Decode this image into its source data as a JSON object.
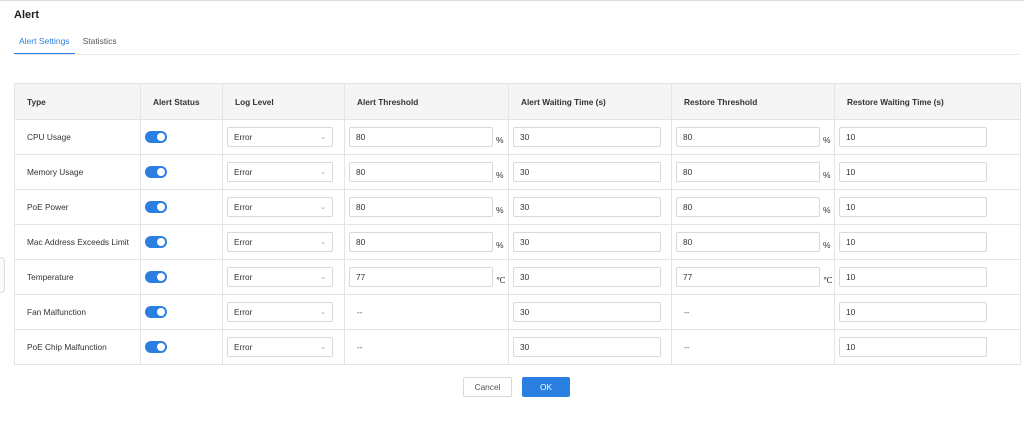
{
  "page": {
    "title": "Alert"
  },
  "tabs": [
    {
      "label": "Alert Settings",
      "active": true
    },
    {
      "label": "Statistics",
      "active": false
    }
  ],
  "table": {
    "headers": [
      "Type",
      "Alert Status",
      "Log Level",
      "Alert Threshold",
      "Alert Waiting Time (s)",
      "Restore Threshold",
      "Restore Waiting Time (s)"
    ],
    "rows": [
      {
        "type": "CPU Usage",
        "alert_status": true,
        "log_level": "Error",
        "alert_threshold": "80",
        "alert_unit": "%",
        "alert_wait": "30",
        "restore_threshold": "80",
        "restore_unit": "%",
        "restore_wait": "10"
      },
      {
        "type": "Memory Usage",
        "alert_status": true,
        "log_level": "Error",
        "alert_threshold": "80",
        "alert_unit": "%",
        "alert_wait": "30",
        "restore_threshold": "80",
        "restore_unit": "%",
        "restore_wait": "10"
      },
      {
        "type": "PoE Power",
        "alert_status": true,
        "log_level": "Error",
        "alert_threshold": "80",
        "alert_unit": "%",
        "alert_wait": "30",
        "restore_threshold": "80",
        "restore_unit": "%",
        "restore_wait": "10"
      },
      {
        "type": "Mac Address Exceeds Limit",
        "alert_status": true,
        "log_level": "Error",
        "alert_threshold": "80",
        "alert_unit": "%",
        "alert_wait": "30",
        "restore_threshold": "80",
        "restore_unit": "%",
        "restore_wait": "10"
      },
      {
        "type": "Temperature",
        "alert_status": true,
        "log_level": "Error",
        "alert_threshold": "77",
        "alert_unit": "℃",
        "alert_wait": "30",
        "restore_threshold": "77",
        "restore_unit": "℃",
        "restore_wait": "10"
      },
      {
        "type": "Fan Malfunction",
        "alert_status": true,
        "log_level": "Error",
        "alert_threshold_text": "--",
        "alert_wait": "30",
        "restore_threshold_text": "--",
        "restore_wait": "10"
      },
      {
        "type": "PoE Chip Malfunction",
        "alert_status": true,
        "log_level": "Error",
        "alert_threshold_text": "--",
        "alert_wait": "30",
        "restore_threshold_text": "--",
        "restore_wait": "10"
      }
    ]
  },
  "buttons": {
    "cancel": "Cancel",
    "ok": "OK"
  },
  "colors": {
    "accent": "#2b7fe0"
  }
}
